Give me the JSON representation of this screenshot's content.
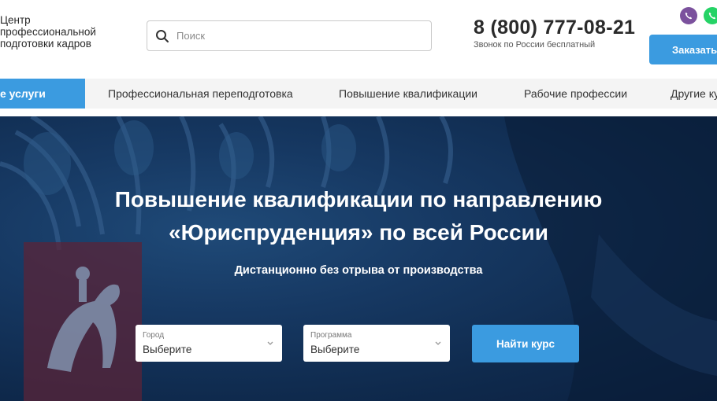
{
  "header": {
    "logo_lines": [
      "Центр",
      "профессиональной",
      "подготовки кадров"
    ],
    "search_placeholder": "Поиск",
    "phone": "8 (800) 777-08-21",
    "phone_note": "Звонок по России бесплатный",
    "order_button": "Заказать",
    "messenger_icons": [
      "viber-icon",
      "whatsapp-icon"
    ]
  },
  "nav": {
    "items": [
      {
        "label": "е услуги",
        "active": true
      },
      {
        "label": "Профессиональная переподготовка",
        "active": false
      },
      {
        "label": "Повышение квалификации",
        "active": false
      },
      {
        "label": "Рабочие профессии",
        "active": false
      },
      {
        "label": "Другие ку",
        "active": false
      }
    ]
  },
  "hero": {
    "title_lines": [
      "Повышение квалификации по направлению",
      "«Юриспруденция» по всей России"
    ],
    "subtitle": "Дистанционно без отрыва от производства",
    "city_select": {
      "label": "Город",
      "value": "Выберите"
    },
    "program_select": {
      "label": "Программа",
      "value": "Выберите"
    },
    "find_button": "Найти курс"
  },
  "colors": {
    "accent": "#3b9be0",
    "hero_bg": "#163862",
    "viber": "#7b519d",
    "whatsapp": "#25d366"
  }
}
